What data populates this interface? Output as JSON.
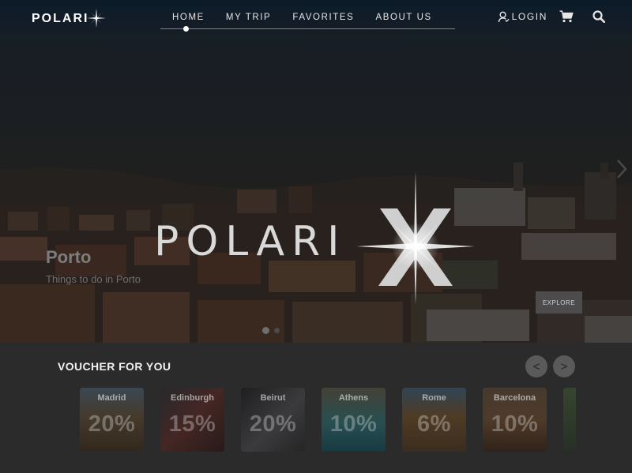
{
  "brand": {
    "name": "POLARI",
    "hero_logo": "POLARI"
  },
  "nav": {
    "links": [
      "HOME",
      "MY TRIP",
      "FAVORITES",
      "ABOUT US"
    ],
    "active": "HOME",
    "login_label": "LOGIN",
    "icons": [
      "user-icon",
      "cart-icon",
      "search-icon"
    ]
  },
  "hero": {
    "title": "Porto",
    "subtitle": "Things to do in Porto",
    "explore_label": "EXPLORE",
    "next_icon": "chevron-right-icon"
  },
  "vouchers": {
    "title": "VOUCHER FOR YOU",
    "prev_label": "<",
    "next_label": ">",
    "items": [
      {
        "city": "Madrid",
        "discount": "20%",
        "color": "#6b5a44"
      },
      {
        "city": "Edinburgh",
        "discount": "15%",
        "color": "#5a3b36"
      },
      {
        "city": "Beirut",
        "discount": "20%",
        "color": "#4a4a4c"
      },
      {
        "city": "Athens",
        "discount": "10%",
        "color": "#2f5a5e"
      },
      {
        "city": "Rome",
        "discount": "6%",
        "color": "#5e4a32"
      },
      {
        "city": "Barcelona",
        "discount": "10%",
        "color": "#5d4634"
      },
      {
        "city": "",
        "discount": "",
        "color": "#3d4a3a"
      }
    ]
  },
  "colors": {
    "background": "#2b2b2b",
    "nav_text": "#e6e6e6"
  }
}
